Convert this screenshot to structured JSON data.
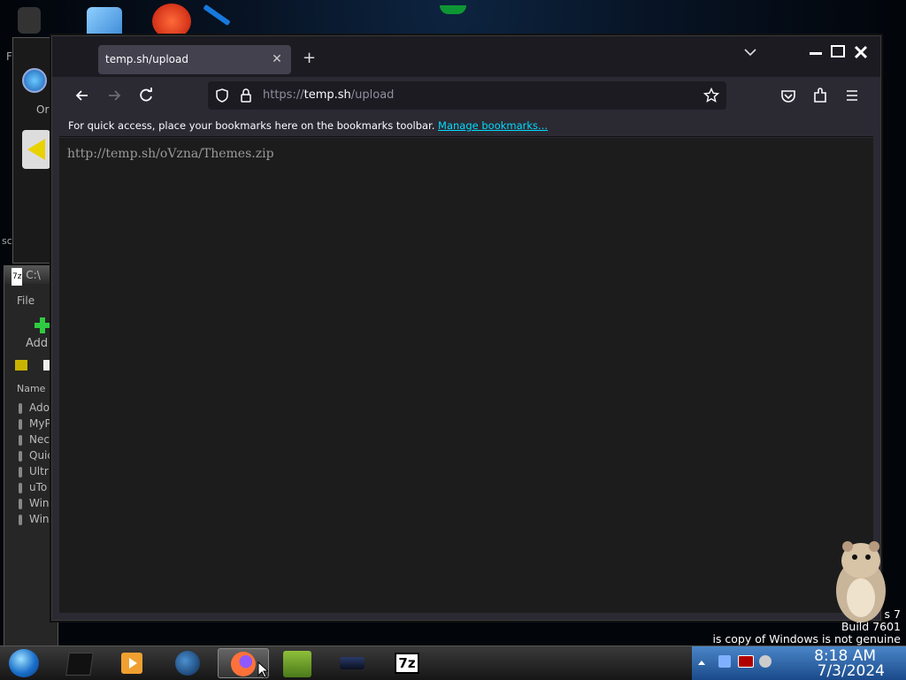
{
  "browser": {
    "tab_title": "temp.sh/upload",
    "url_scheme": "https://",
    "url_host": "temp.sh",
    "url_path": "/upload",
    "bookmarks_message": "For quick access, place your bookmarks here on the bookmarks toolbar.",
    "manage_bookmarks_link": "Manage bookmarks...",
    "page_content": "http://temp.sh/oVzna/Themes.zip"
  },
  "background_window": {
    "title_fragment": "C:\\",
    "menu_file": "File",
    "add_label": "Add",
    "column_name": "Name",
    "rows": [
      "Ado",
      "MyP",
      "Nec",
      "Quic",
      "Ultr",
      "uTo",
      "Win",
      "Win"
    ]
  },
  "top_window": {
    "title_fragment": "Or"
  },
  "desktop_left_text": [
    "F",
    "sc"
  ],
  "watermark": {
    "line1": "s 7",
    "line2": "Build 7601",
    "line3": "is copy of Windows is not genuine"
  },
  "taskbar": {
    "items": [
      "start-orb",
      "app-black",
      "media-player",
      "globe-app",
      "firefox",
      "game-app",
      "dark-app",
      "7zip"
    ],
    "seven_zip_label": "7z",
    "clock_time": "8:18 AM",
    "clock_date": "7/3/2024"
  },
  "colors": {
    "accent_link": "#00ddff",
    "tab_active": "#42414d",
    "toolbar": "#2b2a33"
  }
}
